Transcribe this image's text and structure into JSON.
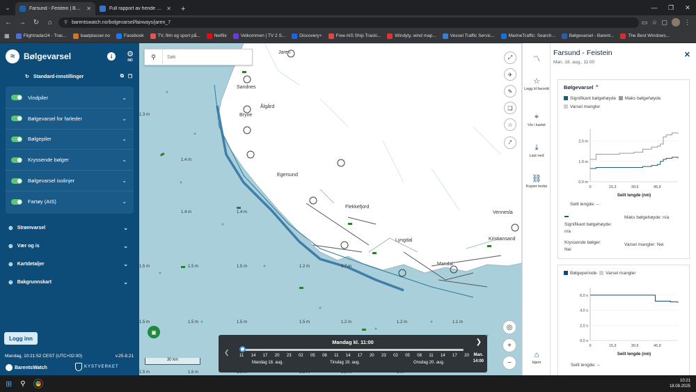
{
  "browser": {
    "tabs": [
      {
        "title": "Farsund - Feistein | Bølgevarsel",
        "active": true
      },
      {
        "title": "Full rapport av hende sesbase - ...",
        "active": false
      }
    ],
    "url": "barentswatch.no/bolgevarsel/fairways/jaren_7",
    "bookmarks": [
      "Flightradar24 - Trac...",
      "baatplasser.no",
      "Facebook",
      "TV, film og sport på...",
      "Netflix",
      "Velkommen | TV 2 S...",
      "Discovery+",
      "Free AIS Ship Tracki...",
      "Windyty, wind map...",
      "Vessel Traffic Servic...",
      "MarineTraffic: Search...",
      "Bølgevarsel - Barent...",
      "The Best Windows..."
    ]
  },
  "sidebar": {
    "brand": "Bølgevarsel",
    "lang_code": "NO",
    "settings_label": "Standard-innstillinger",
    "layers": [
      {
        "label": "Vindpiler",
        "on": true
      },
      {
        "label": "Bølgevarsel for farleder",
        "on": true
      },
      {
        "label": "Bølgepiler",
        "on": true
      },
      {
        "label": "Kryssende bølger",
        "on": true
      },
      {
        "label": "Bølgevarsel isolinjer",
        "on": true
      },
      {
        "label": "Fartøy (AIS)",
        "on": true
      }
    ],
    "groups": [
      "Strømvarsel",
      "Vær og is",
      "Kartdetaljer",
      "Bakgrunnskart"
    ],
    "login_label": "Logg inn",
    "timestamp": "Mandag, 10:21:52 CEST (UTC+02:00)",
    "version": "v.25.8.21",
    "partner_left": "BarentsWatch",
    "partner_right": "KYSTVERKET"
  },
  "map": {
    "search_placeholder": "Søk",
    "places": [
      "Jaren",
      "Sandnes",
      "Ålgård",
      "Bryne",
      "Egersund",
      "Flekkefjord",
      "Lyngdal",
      "Mandal",
      "Kristiansand",
      "Vennesla"
    ],
    "depth_label": "m",
    "scale_label": "30 km"
  },
  "timeline": {
    "title": "Mandag kl. 11:00",
    "hours": [
      "11",
      "14",
      "17",
      "20",
      "23",
      "02",
      "05",
      "08",
      "11",
      "14",
      "17",
      "20",
      "23",
      "02",
      "05",
      "08",
      "11",
      "14",
      "17",
      "20"
    ],
    "days": [
      "Mandag 18. aug.",
      "Tirsdag 19. aug.",
      "Onsdag 20. aug."
    ],
    "end_day": "Man.",
    "end_time": "14:00"
  },
  "iconstrip": {
    "favorite": "Legg til favoritt",
    "show_map": "Vis i kartet",
    "download": "Last ned",
    "copy_link": "Kopier lenke",
    "home": "Hjem"
  },
  "panel": {
    "title": "Farsund - Feistein",
    "subtitle": "Man. 18. aug., 11:00",
    "wave_section": "Bølgevarsel",
    "legend1": [
      "Signifikant bølgehøyde",
      "Maks bølgehøyde",
      "Varsel mangler"
    ],
    "chart1_xlabel": "Seilt lengde (nm)",
    "sailed_label": "Seilt lengde:",
    "sailed_value": "--",
    "sig_label": "Signifikant bølgehøyde:",
    "sig_value": "n/a",
    "max_label": "Maks bølgehøyde:",
    "max_value": "n/a",
    "cross_label": "Kryssende bølger:",
    "cross_value": "Nei",
    "missing_label": "Varsel mangler:",
    "missing_value": "Nei",
    "legend2": [
      "Bølgeperiode",
      "Varsel mangler"
    ],
    "chart2_xlabel": "Seilt lengde (nm)",
    "sailed2_label": "Seilt lengde:",
    "sailed2_value": "--",
    "colors": {
      "sig": "#1b5e6e",
      "max": "#999999",
      "missing": "#d0d0d0"
    }
  },
  "taskbar": {
    "time": "10:21",
    "date": "18.08.2025"
  },
  "chart_data": [
    {
      "type": "line",
      "x_ticks": [
        "0",
        "15,3",
        "30,6",
        "45,9"
      ],
      "y_ticks": [
        "0,0 m",
        "1,0 m",
        "2,0 m"
      ],
      "ylim": [
        0,
        2.6
      ],
      "xlabel": "Seilt lengde (nm)",
      "ylabel": "",
      "x": [
        0,
        4,
        10,
        20,
        30,
        36,
        42,
        46,
        48,
        50,
        52,
        56,
        60
      ],
      "series": [
        {
          "name": "Signifikant bølgehøyde",
          "values": [
            0.65,
            0.7,
            0.7,
            0.7,
            0.7,
            0.75,
            0.8,
            0.85,
            1.0,
            1.1,
            1.15,
            1.2,
            1.15
          ]
        },
        {
          "name": "Maks bølgehøyde",
          "values": [
            1.1,
            1.35,
            1.35,
            1.4,
            1.45,
            1.6,
            1.7,
            1.75,
            1.85,
            2.2,
            2.3,
            2.4,
            2.35
          ]
        }
      ]
    },
    {
      "type": "line",
      "x_ticks": [
        "0",
        "15,3",
        "30,6",
        "45,9"
      ],
      "y_ticks": [
        "0,0 s",
        "2,0 s",
        "4,0 s",
        "6,0 s"
      ],
      "ylim": [
        0,
        7
      ],
      "xlabel": "Seilt lengde (nm)",
      "ylabel": "",
      "x": [
        0,
        20,
        40,
        44,
        44.5,
        55,
        60
      ],
      "series": [
        {
          "name": "Bølgeperiode",
          "values": [
            6.0,
            6.0,
            6.0,
            6.0,
            5.2,
            5.1,
            5.0
          ]
        }
      ]
    }
  ]
}
